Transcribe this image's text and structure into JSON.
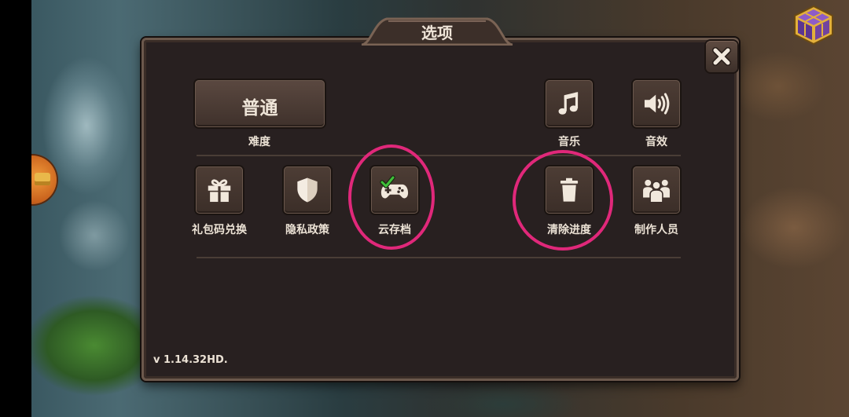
{
  "dialog": {
    "title": "选项"
  },
  "difficulty": {
    "value": "普通",
    "caption": "难度"
  },
  "music": {
    "caption": "音乐",
    "icon": "music-note-icon"
  },
  "sound": {
    "caption": "音效",
    "icon": "speaker-icon"
  },
  "actions": [
    {
      "caption": "礼包码兑换",
      "icon": "gift-icon"
    },
    {
      "caption": "隐私政策",
      "icon": "shield-icon"
    },
    {
      "caption": "云存档",
      "icon": "gamepad-icon",
      "badge": "checkmark-icon"
    },
    {
      "caption": "清除进度",
      "icon": "trash-icon"
    },
    {
      "caption": "制作人员",
      "icon": "people-icon"
    }
  ],
  "version": "v 1.14.32HD.",
  "close_icon": "close-icon",
  "corner_icons": {
    "top_right": "cube-icon",
    "left_edge": "chest-icon"
  },
  "annotations": {
    "color": "#e0287a"
  },
  "colors": {
    "panel": "#282020",
    "button": "#3d302a",
    "text": "#ece2d5",
    "check": "#3fc03a"
  }
}
